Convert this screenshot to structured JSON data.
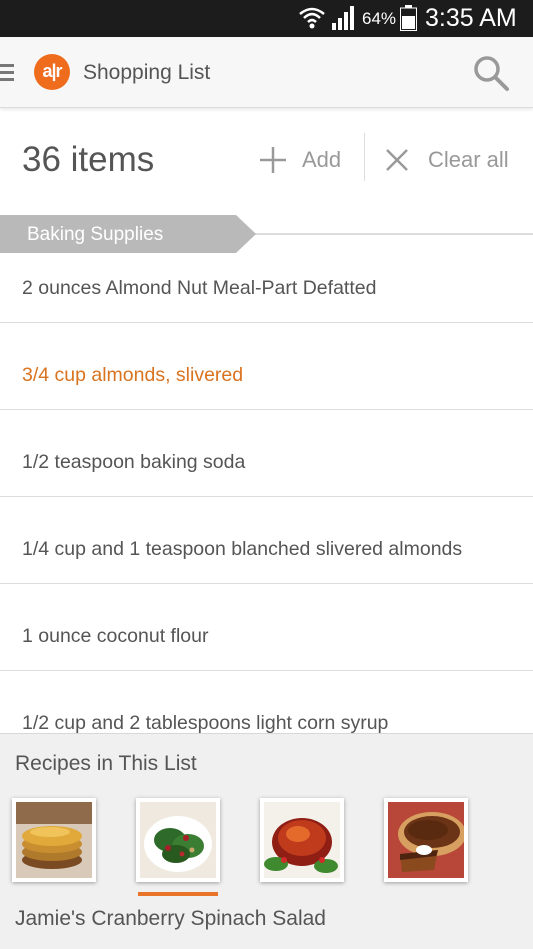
{
  "status_bar": {
    "battery": "64%",
    "time": "3:35 AM"
  },
  "app_bar": {
    "logo_text": "a|r",
    "title": "Shopping List"
  },
  "header": {
    "items_count": "36 items",
    "add_label": "Add",
    "clear_label": "Clear all"
  },
  "section": {
    "label": "Baking Supplies"
  },
  "items": [
    "2 ounces Almond Nut Meal-Part Defatted",
    "3/4 cup almonds, slivered",
    "1/2 teaspoon baking soda",
    "1/4 cup and 1 teaspoon blanched slivered almonds",
    "1 ounce coconut flour",
    "1/2 cup and 2 tablespoons light corn syrup"
  ],
  "recipes": {
    "title": "Recipes in This List",
    "selected_name": "Jamie's Cranberry Spinach Salad",
    "thumbnails": [
      "pancakes-image",
      "spinach-salad-image",
      "glazed-ham-image",
      "pecan-pie-image"
    ],
    "selected_index": 1
  },
  "colors": {
    "accent": "#e8742a",
    "highlight_text": "#d9731f",
    "status_bar_bg": "#1c1c1c",
    "section_tag_bg": "#b9b9b9"
  }
}
